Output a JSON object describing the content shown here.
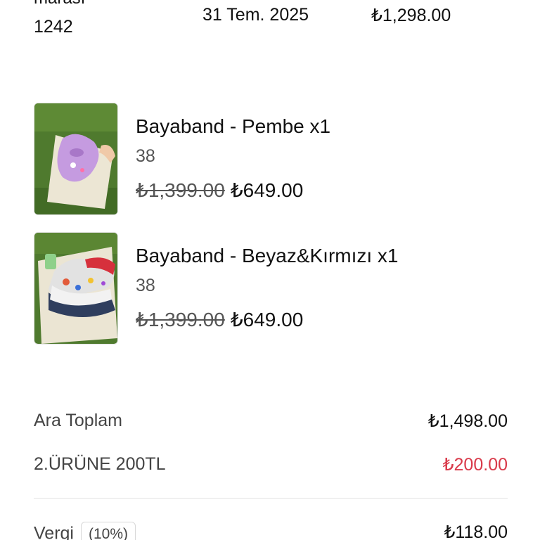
{
  "order": {
    "label_partial": "marası",
    "number": "1242",
    "date": "31 Tem. 2025",
    "total": "₺1,298.00"
  },
  "products": [
    {
      "name": "Bayaband - Pembe x1",
      "size": "38",
      "old_price": "₺1,399.00",
      "new_price": "₺649.00",
      "image_desc": "pink clog on grass"
    },
    {
      "name": "Bayaband - Beyaz&Kırmızı x1",
      "size": "38",
      "old_price": "₺1,399.00",
      "new_price": "₺649.00",
      "image_desc": "white and red clogs on grass"
    }
  ],
  "summary": {
    "subtotal_label": "Ara Toplam",
    "subtotal_value": "₺1,498.00",
    "discount_label": "2.ÜRÜNE 200TL",
    "discount_value": "₺200.00",
    "tax_label": "Vergi",
    "tax_rate": "(10%)",
    "tax_value": "₺118.00"
  },
  "colors": {
    "discount": "#d93a4a",
    "muted_text": "#555555",
    "divider": "#e2e2e2"
  }
}
